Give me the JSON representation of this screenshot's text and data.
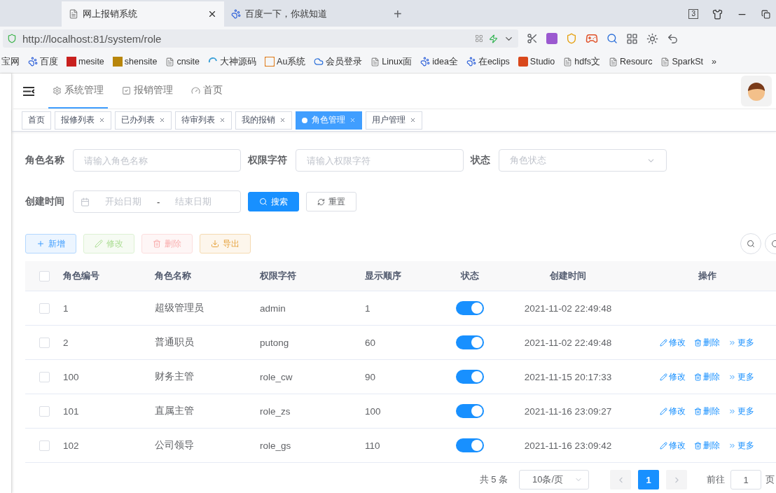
{
  "browser": {
    "tabs": [
      {
        "title": "网上报销系统",
        "selected": true,
        "kind": "page"
      },
      {
        "title": "百度一下，你就知道",
        "selected": false,
        "kind": "paw"
      }
    ],
    "new_tab": "+",
    "tab_count": "3",
    "address": "http://localhost:81/system/role",
    "bookmarks": [
      {
        "label": "宝网",
        "kind": "none"
      },
      {
        "label": "百度",
        "kind": "paw"
      },
      {
        "label": "mesite",
        "kind": "red"
      },
      {
        "label": "shensite",
        "kind": "god"
      },
      {
        "label": "cnsite",
        "kind": "page"
      },
      {
        "label": "大神源码",
        "kind": "swirl"
      },
      {
        "label": "Au系统",
        "kind": "orange"
      },
      {
        "label": "会员登录",
        "kind": "cloud"
      },
      {
        "label": "Linux面",
        "kind": "page"
      },
      {
        "label": "idea全",
        "kind": "paw"
      },
      {
        "label": "在eclips",
        "kind": "paw"
      },
      {
        "label": "Studio",
        "kind": "c"
      },
      {
        "label": "hdfs文",
        "kind": "page"
      },
      {
        "label": "Resourc",
        "kind": "page"
      },
      {
        "label": "SparkSt",
        "kind": "page"
      }
    ],
    "more": "»"
  },
  "app": {
    "topnav": [
      {
        "label": "系统管理",
        "selected": true,
        "kind": "gear"
      },
      {
        "label": "报销管理",
        "selected": false,
        "kind": "check"
      },
      {
        "label": "首页",
        "selected": false,
        "kind": "gauge"
      }
    ],
    "tags": [
      {
        "label": "首页",
        "selected": false,
        "closable": false
      },
      {
        "label": "报修列表",
        "selected": false,
        "closable": true
      },
      {
        "label": "已办列表",
        "selected": false,
        "closable": true
      },
      {
        "label": "待审列表",
        "selected": false,
        "closable": true
      },
      {
        "label": "我的报销",
        "selected": false,
        "closable": true
      },
      {
        "label": "角色管理",
        "selected": true,
        "closable": true
      },
      {
        "label": "用户管理",
        "selected": false,
        "closable": true
      }
    ],
    "filters": {
      "role_name": {
        "label": "角色名称",
        "placeholder": "请输入角色名称"
      },
      "role_key": {
        "label": "权限字符",
        "placeholder": "请输入权限字符"
      },
      "status": {
        "label": "状态",
        "placeholder": "角色状态"
      },
      "created": {
        "label": "创建时间",
        "start_placeholder": "开始日期",
        "separator": "-",
        "end_placeholder": "结束日期"
      },
      "search_button": "搜索",
      "reset_button": "重置"
    },
    "toolbar": [
      {
        "label": "新增",
        "kind": "primary",
        "disabled": false
      },
      {
        "label": "修改",
        "kind": "success",
        "disabled": true
      },
      {
        "label": "删除",
        "kind": "danger",
        "disabled": true
      },
      {
        "label": "导出",
        "kind": "warning",
        "disabled": false
      }
    ],
    "table": {
      "select_all_checked": false,
      "columns": [
        "角色编号",
        "角色名称",
        "权限字符",
        "显示顺序",
        "状态",
        "创建时间",
        "操作"
      ],
      "rows": [
        {
          "checked": false,
          "id": "1",
          "name": "超级管理员",
          "key": "admin",
          "order": "1",
          "on": true,
          "created": "2021-11-02 22:49:48",
          "actions": []
        },
        {
          "checked": false,
          "id": "2",
          "name": "普通职员",
          "key": "putong",
          "order": "60",
          "on": true,
          "created": "2021-11-02 22:49:48",
          "actions": [
            {
              "label": "修改",
              "kind": "edit"
            },
            {
              "label": "删除",
              "kind": "delete"
            },
            {
              "label": "更多",
              "kind": "more"
            }
          ]
        },
        {
          "checked": false,
          "id": "100",
          "name": "财务主管",
          "key": "role_cw",
          "order": "90",
          "on": true,
          "created": "2021-11-15 20:17:33",
          "actions": [
            {
              "label": "修改",
              "kind": "edit"
            },
            {
              "label": "删除",
              "kind": "delete"
            },
            {
              "label": "更多",
              "kind": "more"
            }
          ]
        },
        {
          "checked": false,
          "id": "101",
          "name": "直属主管",
          "key": "role_zs",
          "order": "100",
          "on": true,
          "created": "2021-11-16 23:09:27",
          "actions": [
            {
              "label": "修改",
              "kind": "edit"
            },
            {
              "label": "删除",
              "kind": "delete"
            },
            {
              "label": "更多",
              "kind": "more"
            }
          ]
        },
        {
          "checked": false,
          "id": "102",
          "name": "公司领导",
          "key": "role_gs",
          "order": "110",
          "on": true,
          "created": "2021-11-16 23:09:42",
          "actions": [
            {
              "label": "修改",
              "kind": "edit"
            },
            {
              "label": "删除",
              "kind": "delete"
            },
            {
              "label": "更多",
              "kind": "more"
            }
          ]
        }
      ]
    },
    "pagination": {
      "total": "共 5 条",
      "page_size": "10条/页",
      "pages": [
        {
          "label": "1",
          "selected": true
        }
      ],
      "goto_label": "前往",
      "goto_value": "1",
      "goto_suffix": "页"
    }
  }
}
